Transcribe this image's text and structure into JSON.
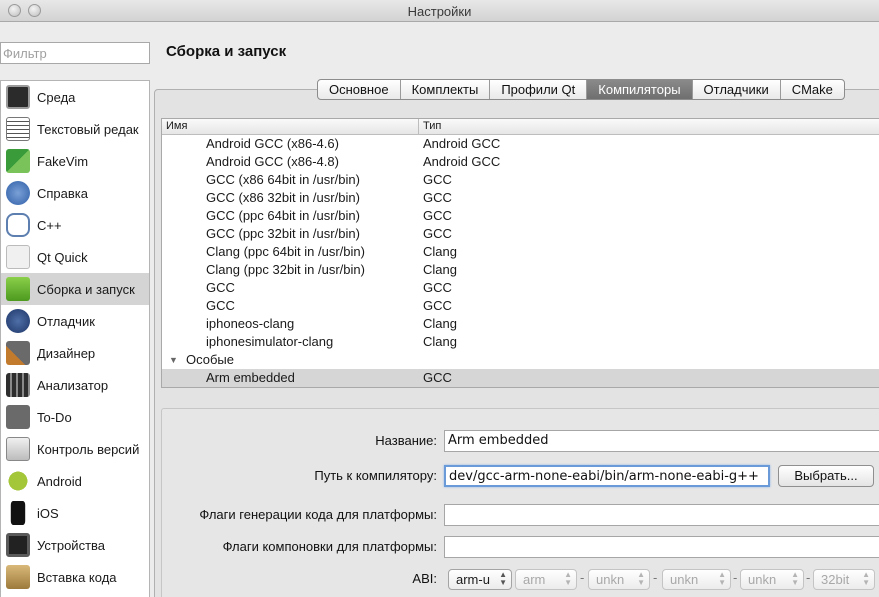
{
  "window": {
    "title": "Настройки"
  },
  "filter": {
    "placeholder": "Фильтр"
  },
  "sidebar": {
    "items": [
      {
        "label": "Среда",
        "icon": "monitor-icon"
      },
      {
        "label": "Текстовый редак",
        "icon": "text-editor-icon"
      },
      {
        "label": "FakeVim",
        "icon": "fakevim-icon"
      },
      {
        "label": "Справка",
        "icon": "help-icon"
      },
      {
        "label": "C++",
        "icon": "braces-icon"
      },
      {
        "label": "Qt Quick",
        "icon": "qt-quick-icon"
      },
      {
        "label": "Сборка и запуск",
        "icon": "build-run-icon"
      },
      {
        "label": "Отладчик",
        "icon": "debugger-icon"
      },
      {
        "label": "Дизайнер",
        "icon": "designer-icon"
      },
      {
        "label": "Анализатор",
        "icon": "analyzer-icon"
      },
      {
        "label": "To-Do",
        "icon": "todo-icon"
      },
      {
        "label": "Контроль версий",
        "icon": "version-control-icon"
      },
      {
        "label": "Android",
        "icon": "android-icon"
      },
      {
        "label": "iOS",
        "icon": "ios-icon"
      },
      {
        "label": "Устройства",
        "icon": "devices-icon"
      },
      {
        "label": "Вставка кода",
        "icon": "code-paste-icon"
      }
    ],
    "active_index": 6
  },
  "page": {
    "title": "Сборка и запуск"
  },
  "tabs": [
    {
      "label": "Основное"
    },
    {
      "label": "Комплекты"
    },
    {
      "label": "Профили Qt"
    },
    {
      "label": "Компиляторы"
    },
    {
      "label": "Отладчики"
    },
    {
      "label": "CMake"
    }
  ],
  "tree": {
    "col_name": "Имя",
    "col_type": "Тип",
    "rows": [
      {
        "name": "Android GCC (x86-4.6)",
        "type": "Android GCC"
      },
      {
        "name": "Android GCC (x86-4.8)",
        "type": "Android GCC"
      },
      {
        "name": "GCC (x86 64bit in /usr/bin)",
        "type": "GCC"
      },
      {
        "name": "GCC (x86 32bit in /usr/bin)",
        "type": "GCC"
      },
      {
        "name": "GCC (ppc 64bit in /usr/bin)",
        "type": "GCC"
      },
      {
        "name": "GCC (ppc 32bit in /usr/bin)",
        "type": "GCC"
      },
      {
        "name": "Clang (ppc 64bit in /usr/bin)",
        "type": "Clang"
      },
      {
        "name": "Clang (ppc 32bit in /usr/bin)",
        "type": "Clang"
      },
      {
        "name": "GCC",
        "type": "GCC"
      },
      {
        "name": "GCC",
        "type": "GCC"
      },
      {
        "name": "iphoneos-clang",
        "type": "Clang"
      },
      {
        "name": "iphonesimulator-clang",
        "type": "Clang"
      }
    ],
    "group": {
      "label": "Особые"
    },
    "manual": [
      {
        "name": "Arm embedded",
        "type": "GCC"
      }
    ]
  },
  "details": {
    "name_label": "Название:",
    "name_value": "Arm embedded",
    "path_label": "Путь к компилятору:",
    "path_value": "dev/gcc-arm-none-eabi/bin/arm-none-eabi-g++",
    "browse_label": "Выбрать...",
    "cflags_label": "Флаги генерации кода для платформы:",
    "cflags_value": "",
    "lflags_label": "Флаги компоновки для платформы:",
    "lflags_value": "",
    "abi_label": "ABI:",
    "abi": [
      "arm-u",
      "arm",
      "unkn",
      "unkn",
      "unkn",
      "32bit"
    ]
  }
}
